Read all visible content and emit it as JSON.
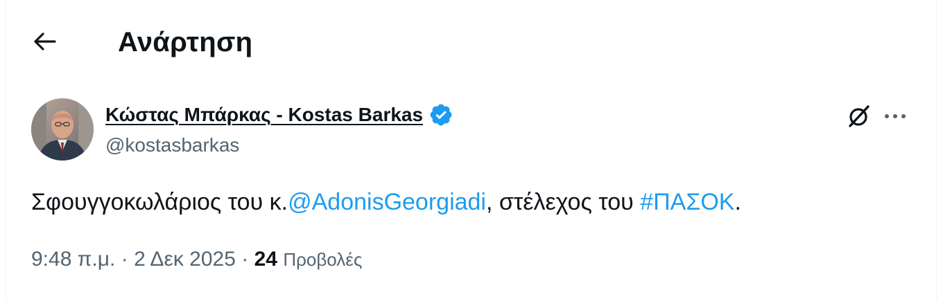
{
  "header": {
    "title": "Ανάρτηση",
    "back_icon": "arrow-left-icon"
  },
  "post": {
    "author": {
      "display_name": "Κώστας Μπάρκας - Kostas Barkas",
      "handle": "@kostasbarkas",
      "verified": true,
      "verified_color": "#1d9bf0"
    },
    "text_parts": {
      "part1": "Σφουγγοκωλάριος του κ.",
      "mention": "@AdonisGeorgiadi",
      "part2": ", στέλεχος του ",
      "hashtag": "#ΠΑΣΟΚ",
      "part3": "."
    },
    "meta": {
      "time": "9:48 π.μ.",
      "separator": " · ",
      "date": "2 Δεκ 2025",
      "views_count": "24",
      "views_label": "Προβολές"
    }
  },
  "colors": {
    "accent": "#1d9bf0",
    "secondary_text": "#536471",
    "primary_text": "#0f1419"
  }
}
